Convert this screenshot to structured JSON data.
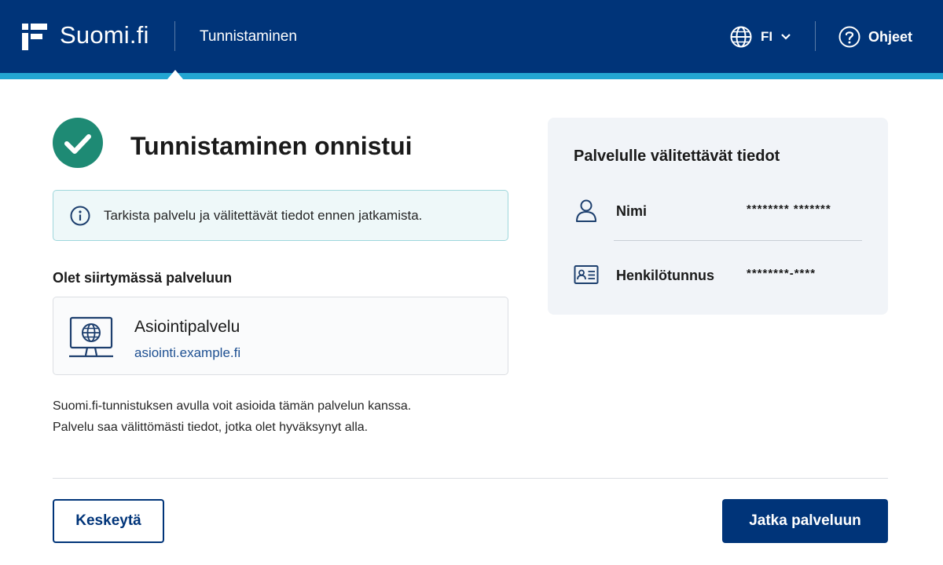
{
  "header": {
    "brand": "Suomi.fi",
    "service_title": "Tunnistaminen",
    "language": {
      "code": "FI",
      "icon": "globe-icon"
    },
    "help_label": "Ohjeet",
    "colors": {
      "background": "#003479",
      "accent": "#23a6d2"
    }
  },
  "main": {
    "title": "Tunnistaminen onnistui",
    "info_text": "Tarkista palvelu ja välitettävät tiedot ennen jatkamista.",
    "section_label": "Olet siirtymässä palveluun",
    "service": {
      "name": "Asiointipalvelu",
      "url": "asiointi.example.fi"
    },
    "description_lines": [
      "Suomi.fi-tunnistuksen avulla voit asioida tämän palvelun kanssa.",
      "Palvelu saa välittömästi tiedot, jotka olet hyväksynyt alla."
    ]
  },
  "panel": {
    "title": "Palvelulle välitettävät tiedot",
    "rows": [
      {
        "label": "Nimi",
        "value": "******** *******",
        "icon": "person-icon"
      },
      {
        "label": "Henkilötunnus",
        "value": "********-****",
        "icon": "id-card-icon"
      }
    ]
  },
  "footer": {
    "cancel_label": "Keskeytä",
    "continue_label": "Jatka palveluun"
  },
  "colors": {
    "primary": "#003479",
    "success": "#1e8a74",
    "link": "#1d4f91"
  }
}
